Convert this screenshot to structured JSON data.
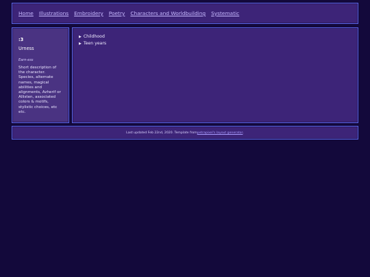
{
  "nav": {
    "links": [
      "Home",
      "Illustrations",
      "Embroidery",
      "Poetry",
      "Characters and Worldbuilding",
      "Systematic"
    ]
  },
  "sidebar": {
    "title": ":3",
    "name": "Urness",
    "subtitle": "Earn-ess",
    "description": "Short description of the character. Species, alternate names, magical abilities and alignments, Azherif or Allisten, associated colors & motifs, stylistic choices, etc etc."
  },
  "main": {
    "sections": [
      "Childhood",
      "Teen years"
    ]
  },
  "footer": {
    "prefix": "Last updated Feb 22nd, 2020. Template from ",
    "link_text": "petrapixel's layout generator",
    "suffix": "."
  },
  "colors": {
    "page_bg": "#13093b",
    "panel_bg": "#3d2478",
    "panel_border": "#5a63e6",
    "link": "#c7b9ff"
  }
}
